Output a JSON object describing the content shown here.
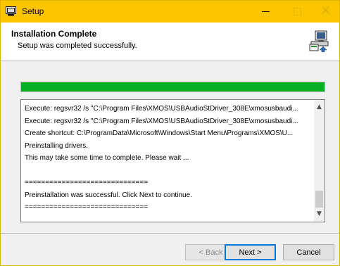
{
  "window": {
    "title": "Setup",
    "icons": {
      "app": "setup-app-icon",
      "minimize": "minimize-icon",
      "maximize": "maximize-icon",
      "close": "close-icon"
    },
    "close_glyph": "✕",
    "title_bar_color": "#fbc600"
  },
  "header": {
    "title": "Installation Complete",
    "subtitle": "Setup was completed successfully.",
    "icon": "installer-computer-icon"
  },
  "progress": {
    "value_percent": 100,
    "color": "#06b025"
  },
  "log": {
    "lines": [
      "Execute: regsvr32 /s \"C:\\Program Files\\XMOS\\USBAudioStDriver_308E\\xmosusbaudi...",
      "Execute: regsvr32 /s \"C:\\Program Files\\XMOS\\USBAudioStDriver_308E\\xmosusbaudi...",
      "Create shortcut: C:\\ProgramData\\Microsoft\\Windows\\Start Menu\\Programs\\XMOS\\U...",
      "Preinstalling drivers.",
      "This may take some time to complete. Please wait ...",
      "",
      "==============================",
      "Preinstallation was successful. Click Next to continue.",
      "=============================="
    ],
    "scroll_up": "▲",
    "scroll_down": "▼"
  },
  "buttons": {
    "back": "< Back",
    "next": "Next >",
    "cancel": "Cancel"
  }
}
